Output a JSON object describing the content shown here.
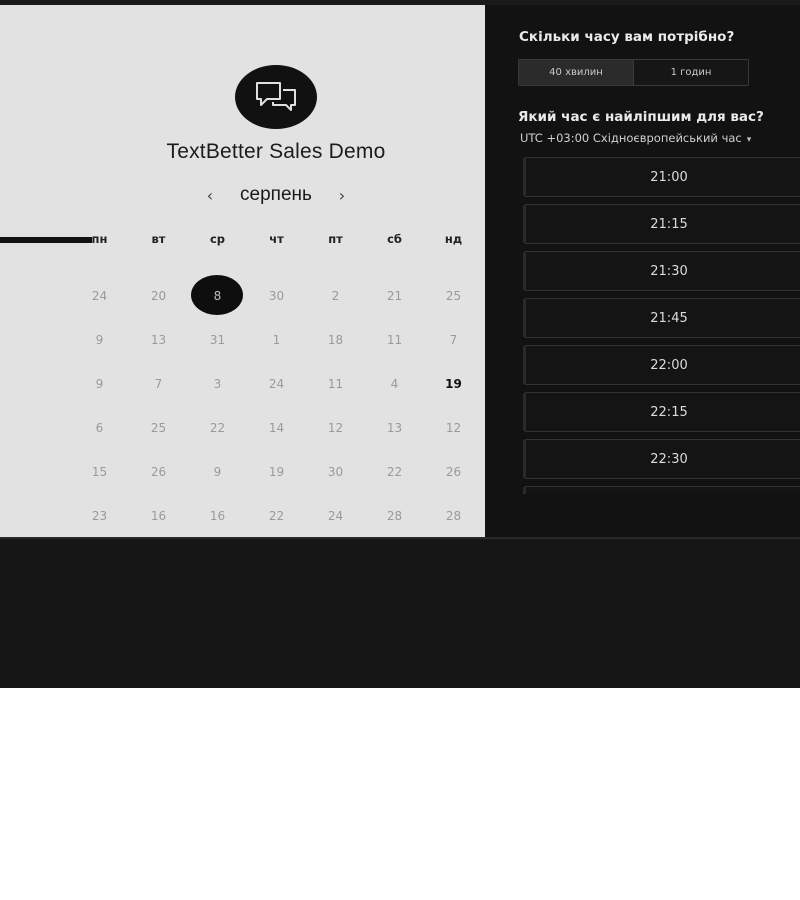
{
  "booking": {
    "title": "TextBetter Sales Demo",
    "month": "серпень",
    "prev_arrow": "‹",
    "next_arrow": "›"
  },
  "calendar": {
    "weekdays": [
      "пн",
      "вт",
      "ср",
      "чт",
      "пт",
      "сб",
      "нд"
    ],
    "weeks": [
      [
        "24",
        "20",
        "8",
        "30",
        "2",
        "21",
        "25"
      ],
      [
        "9",
        "13",
        "31",
        "1",
        "18",
        "11",
        "7"
      ],
      [
        "9",
        "7",
        "3",
        "24",
        "11",
        "4",
        "19"
      ],
      [
        "6",
        "25",
        "22",
        "14",
        "12",
        "13",
        "12"
      ],
      [
        "15",
        "26",
        "9",
        "19",
        "30",
        "22",
        "26"
      ],
      [
        "23",
        "16",
        "16",
        "22",
        "24",
        "28",
        "28"
      ]
    ],
    "selected_day": "8"
  },
  "duration": {
    "question": "Скільки часу вам потрібно?",
    "options": [
      "40 хвилин",
      "1 годин"
    ],
    "selected": "40 хвилин"
  },
  "time": {
    "question": "Який час є найліпшим для вас?",
    "timezone": "UTC +03:00 Східноєвропейський час",
    "timezone_caret": "▾",
    "slots": [
      "21:00",
      "21:15",
      "21:30",
      "21:45",
      "22:00",
      "22:15",
      "22:30"
    ]
  },
  "colors": {
    "left_panel": "#e2e2e2",
    "right_panel": "#121212",
    "selected_day_bg": "#0e0e0e"
  }
}
